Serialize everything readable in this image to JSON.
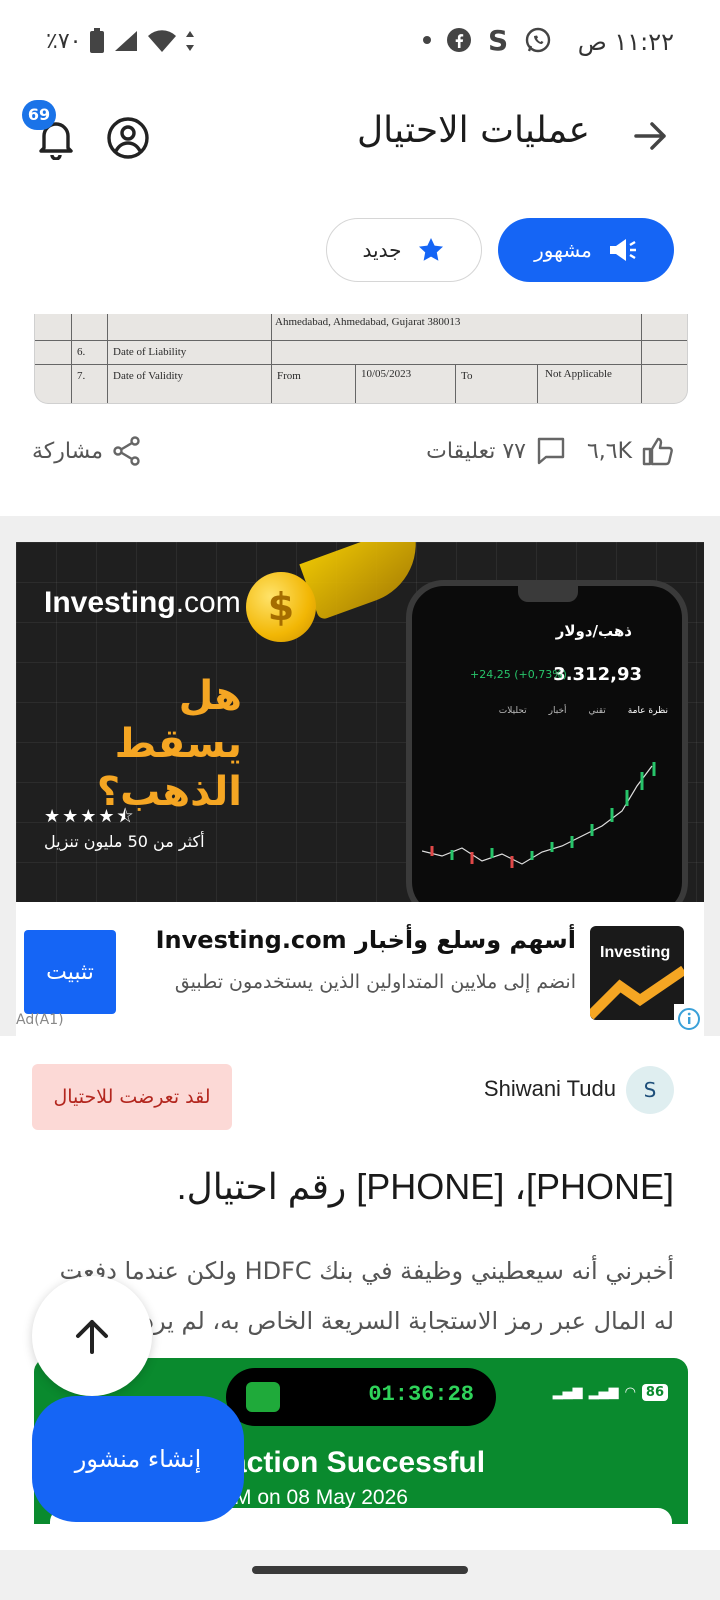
{
  "status_bar": {
    "time": "١١:٢٢ ص",
    "battery": "٪٧٠",
    "app_icons": [
      "whatsapp-icon",
      "s-icon",
      "facebook-icon",
      "dot-icon"
    ]
  },
  "header": {
    "title": "عمليات الاحتيال",
    "notification_count": "69"
  },
  "filters": {
    "popular": "مشهور",
    "new": "جديد"
  },
  "doc": {
    "row1_addr": "Ahmedabad, Ahmedabad, Gujarat  380013",
    "row6_num": "6.",
    "row6_label": "Date of Liability",
    "row7_num": "7.",
    "row7_label": "Date of Validity",
    "row7_from": "From",
    "row7_date": "10/05/2023",
    "row7_to": "To",
    "row7_na": "Not Applicable"
  },
  "post_actions": {
    "likes": "٦,٦K",
    "comments": "٧٧ تعليقات",
    "share": "مشاركة"
  },
  "ad": {
    "brand_bold": "Investing",
    "brand_light": ".com",
    "headline": "هل يسقط الذهب؟",
    "stars": "★★★★⯪",
    "downloads": "أكثر من 50 مليون تنزيل",
    "phone_title": "ذهب/دولار",
    "phone_price": "3.312,93",
    "phone_change": "+24,25 (+0,73%)",
    "phone_tabs": [
      "نظرة عامة",
      "تقني",
      "أخبار",
      "تحليلات"
    ],
    "card_title": "أسهم وسلع وأخبار Investing.com",
    "card_desc": "انضم إلى ملايين المتداولين الذين يستخدمون تطبيق",
    "logo_text": "Investing",
    "install": "تثبيت",
    "ad_tag": "Ad(A1)"
  },
  "post2": {
    "avatar_letter": "S",
    "author": "Shiwani Tudu",
    "badge": "لقد تعرضت للاحتيال",
    "title": "[PHONE]، [PHONE] رقم احتيال.",
    "body": "أخبرني أنه سيعطيني وظيفة في بنك HDFC ولكن عندما دفعت له المال عبر رمز الاستجابة السريعة الخاص به، لم يرد علي"
  },
  "screenshot": {
    "timer": "01:36:28",
    "battery": "86",
    "title": "action Successful",
    "subtitle": "M on 08 May 2026"
  },
  "fab": {
    "create_post": "إنشاء منشور"
  }
}
